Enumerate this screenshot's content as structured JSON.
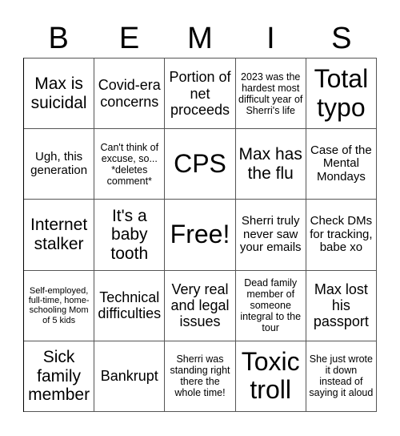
{
  "header": {
    "letters": [
      "B",
      "E",
      "M",
      "I",
      "S"
    ]
  },
  "cells": [
    {
      "text": "Max is suicidal",
      "size": "s-l"
    },
    {
      "text": "Covid-era concerns",
      "size": "s-m"
    },
    {
      "text": "Portion of net proceeds",
      "size": "s-m"
    },
    {
      "text": "2023 was the hardest most difficult year of Sherri's life",
      "size": "s-xs"
    },
    {
      "text": "Total typo",
      "size": "s-xl"
    },
    {
      "text": "Ugh, this generation",
      "size": "s-s"
    },
    {
      "text": "Can't think of excuse, so... *deletes comment*",
      "size": "s-xs"
    },
    {
      "text": "CPS",
      "size": "s-xl"
    },
    {
      "text": "Max has the flu",
      "size": "s-l"
    },
    {
      "text": "Case of the Mental Mondays",
      "size": "s-s"
    },
    {
      "text": "Internet stalker",
      "size": "s-l"
    },
    {
      "text": "It's a baby tooth",
      "size": "s-l"
    },
    {
      "text": "Free!",
      "size": "s-xl"
    },
    {
      "text": "Sherri truly never saw your emails",
      "size": "s-s"
    },
    {
      "text": "Check DMs for tracking, babe xo",
      "size": "s-s"
    },
    {
      "text": "Self-employed, full-time, home-schooling Mom of 5 kids",
      "size": "s-xxs"
    },
    {
      "text": "Technical difficulties",
      "size": "s-m"
    },
    {
      "text": "Very real and legal issues",
      "size": "s-m"
    },
    {
      "text": "Dead family member of someone integral to the tour",
      "size": "s-xs"
    },
    {
      "text": "Max lost his passport",
      "size": "s-m"
    },
    {
      "text": "Sick family member",
      "size": "s-l"
    },
    {
      "text": "Bankrupt",
      "size": "s-m"
    },
    {
      "text": "Sherri was standing right there the whole time!",
      "size": "s-xs"
    },
    {
      "text": "Toxic troll",
      "size": "s-xl"
    },
    {
      "text": "She just wrote it down instead of saying it aloud",
      "size": "s-xs"
    }
  ]
}
